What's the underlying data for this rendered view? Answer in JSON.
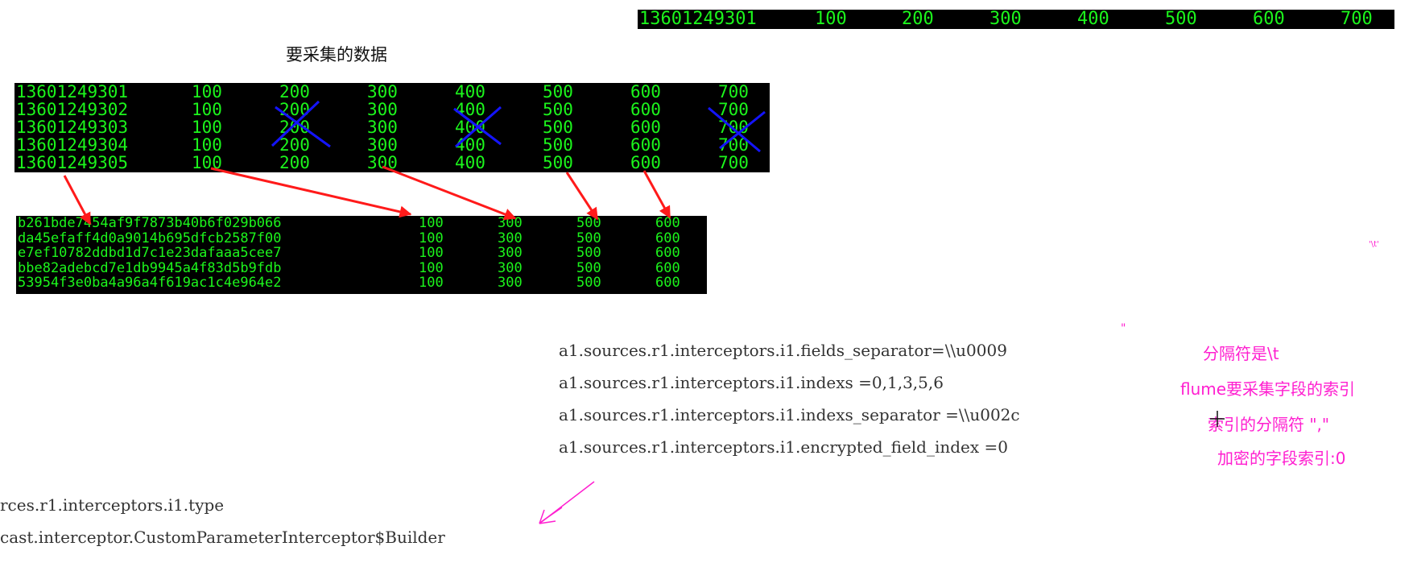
{
  "top_strip": {
    "cells": [
      "13601249301",
      "100",
      "200",
      "300",
      "400",
      "500",
      "600",
      "700"
    ]
  },
  "heading": "要采集的数据",
  "source_table": {
    "rows": [
      [
        "13601249301",
        "100",
        "200",
        "300",
        "400",
        "500",
        "600",
        "700"
      ],
      [
        "13601249302",
        "100",
        "200",
        "300",
        "400",
        "500",
        "600",
        "700"
      ],
      [
        "13601249303",
        "100",
        "200",
        "300",
        "400",
        "500",
        "600",
        "700"
      ],
      [
        "13601249304",
        "100",
        "200",
        "300",
        "400",
        "500",
        "600",
        "700"
      ],
      [
        "13601249305",
        "100",
        "200",
        "300",
        "400",
        "500",
        "600",
        "700"
      ]
    ]
  },
  "result_table": {
    "rows": [
      [
        "b261bde7454af9f7873b40b6f029b066",
        "100",
        "300",
        "500",
        "600"
      ],
      [
        "da45efaff4d0a9014b695dfcb2587f00",
        "100",
        "300",
        "500",
        "600"
      ],
      [
        "e7ef10782ddbd1d7c1e23dafaaa5cee7",
        "100",
        "300",
        "500",
        "600"
      ],
      [
        "bbe82adebcd7e1db9945a4f83d5b9fdb",
        "100",
        "300",
        "500",
        "600"
      ],
      [
        "53954f3e0ba4a96a4f619ac1c4e964e2",
        "100",
        "300",
        "500",
        "600"
      ]
    ]
  },
  "config_lines": [
    "a1.sources.r1.interceptors.i1.fields_separator=\\\\u0009",
    "a1.sources.r1.interceptors.i1.indexs =0,1,3,5,6",
    "a1.sources.r1.interceptors.i1.indexs_separator =\\\\u002c",
    "a1.sources.r1.interceptors.i1.encrypted_field_index =0"
  ],
  "annotations": [
    "分隔符是\\t",
    "flume要采集字段的索引",
    "索引的分隔符 \",\"",
    "加密的字段索引:0"
  ],
  "small_marks": {
    "tab_hint": "'\\t'",
    "quote_mark": "\""
  },
  "bottom_lines": [
    "rces.r1.interceptors.i1.type",
    "cast.interceptor.CustomParameterInterceptor$Builder"
  ],
  "colors": {
    "terminal_bg": "#000000",
    "terminal_text": "#1cf51c",
    "annotation": "#ff1fd0",
    "arrow": "#ff1a1a",
    "cross": "#1414ff"
  }
}
